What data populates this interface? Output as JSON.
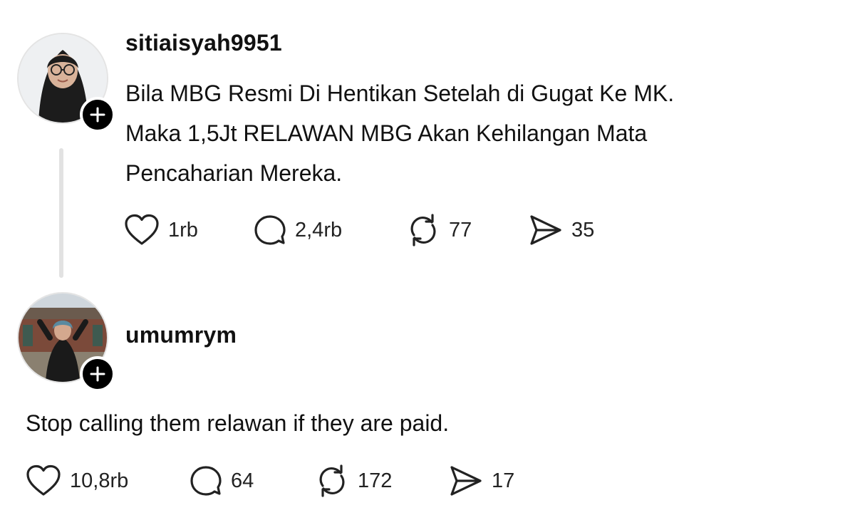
{
  "posts": [
    {
      "username": "sitiaisyah9951",
      "text": "Bila MBG Resmi Di Hentikan Setelah di Gugat Ke MK.\nMaka 1,5Jt RELAWAN MBG Akan Kehilangan Mata\nPencaharian Mereka.",
      "likes": "1rb",
      "replies": "2,4rb",
      "reposts": "77",
      "shares": "35"
    },
    {
      "username": "umumrym",
      "text": "Stop calling them relawan if they are paid.",
      "likes": "10,8rb",
      "replies": "64",
      "reposts": "172",
      "shares": "17"
    }
  ],
  "icons": {
    "like": "heart-icon",
    "reply": "comment-icon",
    "repost": "repost-icon",
    "share": "send-icon",
    "follow": "plus-icon"
  },
  "colors": {
    "background": "#ffffff",
    "text": "#111111",
    "thread_line": "#e2e2e2",
    "follow_button": "#000000"
  }
}
